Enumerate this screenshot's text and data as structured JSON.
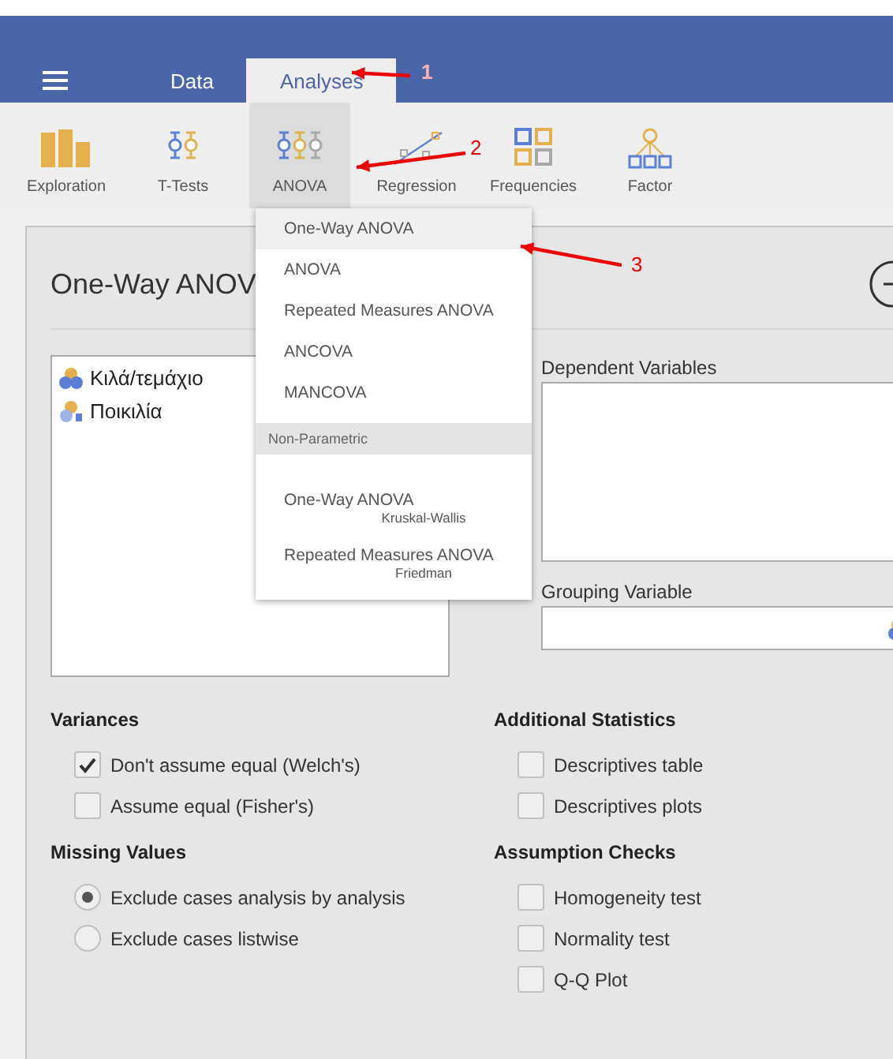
{
  "tabs": [
    {
      "label": "Data",
      "selected": false
    },
    {
      "label": "Analyses",
      "selected": true
    }
  ],
  "toolbar": [
    {
      "label": "Exploration",
      "kind": "exploration",
      "selected": false
    },
    {
      "label": "T-Tests",
      "kind": "ttests",
      "selected": false
    },
    {
      "label": "ANOVA",
      "kind": "anova",
      "selected": true
    },
    {
      "label": "Regression",
      "kind": "regression",
      "selected": false
    },
    {
      "label": "Frequencies",
      "kind": "frequencies",
      "selected": false
    },
    {
      "label": "Factor",
      "kind": "factor",
      "selected": false
    }
  ],
  "dropdown": [
    {
      "kind": "item",
      "label": "One-Way ANOVA",
      "highlighted": true
    },
    {
      "kind": "item",
      "label": "ANOVA",
      "highlighted": false
    },
    {
      "kind": "item",
      "label": "Repeated Measures ANOVA",
      "highlighted": false
    },
    {
      "kind": "item",
      "label": "ANCOVA",
      "highlighted": false
    },
    {
      "kind": "item",
      "label": "MANCOVA",
      "highlighted": false
    },
    {
      "kind": "header",
      "label": "Non-Parametric"
    },
    {
      "kind": "item",
      "label": "One-Way ANOVA",
      "sublabel": "Kruskal-Wallis",
      "highlighted": false
    },
    {
      "kind": "item",
      "label": "Repeated Measures ANOVA",
      "sublabel": "Friedman",
      "highlighted": false
    }
  ],
  "panel": {
    "title": "One-Way ANOV",
    "variables": [
      {
        "name": "Κιλά/τεμάχιο",
        "kind": "continuous"
      },
      {
        "name": "Ποικιλία",
        "kind": "nominal"
      }
    ],
    "dependent_label": "Dependent Variables",
    "grouping_label": "Grouping Variable",
    "sections": [
      {
        "title": "Variances",
        "options": [
          {
            "kind": "checkbox",
            "label": "Don't assume equal (Welch's)",
            "checked": true
          },
          {
            "kind": "checkbox",
            "label": "Assume equal (Fisher's)",
            "checked": false
          }
        ]
      },
      {
        "title": "Additional Statistics",
        "options": [
          {
            "kind": "checkbox",
            "label": "Descriptives table",
            "checked": false
          },
          {
            "kind": "checkbox",
            "label": "Descriptives plots",
            "checked": false
          }
        ]
      },
      {
        "title": "Missing Values",
        "options": [
          {
            "kind": "radio",
            "label": "Exclude cases analysis by analysis",
            "selected": true
          },
          {
            "kind": "radio",
            "label": "Exclude cases listwise",
            "selected": false
          }
        ]
      },
      {
        "title": "Assumption Checks",
        "options": [
          {
            "kind": "checkbox",
            "label": "Homogeneity test",
            "checked": false
          },
          {
            "kind": "checkbox",
            "label": "Normality test",
            "checked": false
          },
          {
            "kind": "checkbox",
            "label": "Q-Q Plot",
            "checked": false
          }
        ]
      }
    ]
  },
  "annotations": [
    {
      "label": "1"
    },
    {
      "label": "2"
    },
    {
      "label": "3"
    }
  ]
}
